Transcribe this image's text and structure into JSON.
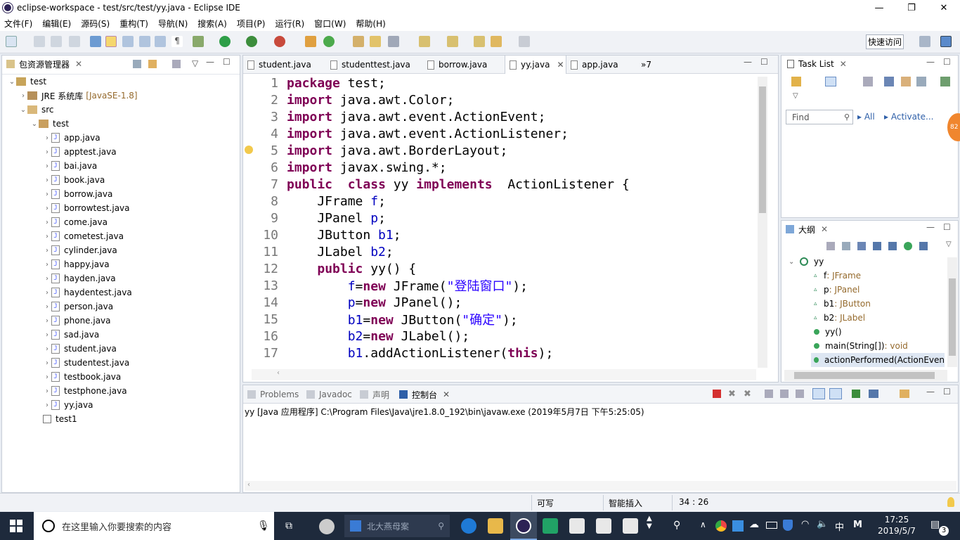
{
  "window": {
    "title": "eclipse-workspace - test/src/test/yy.java - Eclipse IDE"
  },
  "menu": [
    "文件(F)",
    "编辑(E)",
    "源码(S)",
    "重构(T)",
    "导航(N)",
    "搜索(A)",
    "项目(P)",
    "运行(R)",
    "窗口(W)",
    "帮助(H)"
  ],
  "toolbar": {
    "quick_access": "快速访问"
  },
  "package_explorer": {
    "tab": "包资源管理器",
    "project": "test",
    "jre": "JRE 系统库",
    "jre_version": "[JavaSE-1.8]",
    "src": "src",
    "package": "test",
    "files": [
      "app.java",
      "apptest.java",
      "bai.java",
      "book.java",
      "borrow.java",
      "borrowtest.java",
      "come.java",
      "cometest.java",
      "cylinder.java",
      "happy.java",
      "hayden.java",
      "haydentest.java",
      "person.java",
      "phone.java",
      "sad.java",
      "student.java",
      "studentest.java",
      "testbook.java",
      "testphone.java",
      "yy.java"
    ],
    "project2": "test1"
  },
  "editor": {
    "tabs": [
      "student.java",
      "studenttest.java",
      "borrow.java",
      "yy.java",
      "app.java"
    ],
    "overflow": "»7",
    "lines": [
      {
        "n": "1",
        "parts": [
          {
            "t": "package",
            "c": "kw"
          },
          {
            "t": " test;",
            "c": ""
          }
        ]
      },
      {
        "n": "2",
        "parts": [
          {
            "t": "import",
            "c": "kw"
          },
          {
            "t": " java.awt.Color;",
            "c": ""
          }
        ]
      },
      {
        "n": "3",
        "parts": [
          {
            "t": "import",
            "c": "kw"
          },
          {
            "t": " java.awt.event.ActionEvent;",
            "c": ""
          }
        ]
      },
      {
        "n": "4",
        "parts": [
          {
            "t": "import",
            "c": "kw"
          },
          {
            "t": " java.awt.event.ActionListener;",
            "c": ""
          }
        ]
      },
      {
        "n": "5",
        "parts": [
          {
            "t": "import",
            "c": "kw"
          },
          {
            "t": " java.awt.BorderLayout;",
            "c": ""
          }
        ]
      },
      {
        "n": "6",
        "parts": [
          {
            "t": "import",
            "c": "kw"
          },
          {
            "t": " javax.swing.*;",
            "c": ""
          }
        ]
      },
      {
        "n": "7",
        "parts": [
          {
            "t": "public",
            "c": "kw"
          },
          {
            "t": "  ",
            "c": ""
          },
          {
            "t": "class",
            "c": "kw"
          },
          {
            "t": " yy ",
            "c": ""
          },
          {
            "t": "implements",
            "c": "kw"
          },
          {
            "t": "  ActionListener {",
            "c": ""
          }
        ]
      },
      {
        "n": "8",
        "parts": [
          {
            "t": "    JFrame ",
            "c": ""
          },
          {
            "t": "f",
            "c": "fld"
          },
          {
            "t": ";",
            "c": ""
          }
        ]
      },
      {
        "n": "9",
        "parts": [
          {
            "t": "    JPanel ",
            "c": ""
          },
          {
            "t": "p",
            "c": "fld"
          },
          {
            "t": ";",
            "c": ""
          }
        ]
      },
      {
        "n": "10",
        "parts": [
          {
            "t": "    JButton ",
            "c": ""
          },
          {
            "t": "b1",
            "c": "fld"
          },
          {
            "t": ";",
            "c": ""
          }
        ]
      },
      {
        "n": "11",
        "parts": [
          {
            "t": "    JLabel ",
            "c": ""
          },
          {
            "t": "b2",
            "c": "fld"
          },
          {
            "t": ";",
            "c": ""
          }
        ]
      },
      {
        "n": "12",
        "parts": [
          {
            "t": "    ",
            "c": ""
          },
          {
            "t": "public",
            "c": "kw"
          },
          {
            "t": " yy() {",
            "c": ""
          }
        ]
      },
      {
        "n": "13",
        "parts": [
          {
            "t": "        ",
            "c": ""
          },
          {
            "t": "f",
            "c": "fld"
          },
          {
            "t": "=",
            "c": ""
          },
          {
            "t": "new",
            "c": "kw"
          },
          {
            "t": " JFrame(",
            "c": ""
          },
          {
            "t": "\"登陆窗口\"",
            "c": "str"
          },
          {
            "t": ");",
            "c": ""
          }
        ]
      },
      {
        "n": "14",
        "parts": [
          {
            "t": "        ",
            "c": ""
          },
          {
            "t": "p",
            "c": "fld"
          },
          {
            "t": "=",
            "c": ""
          },
          {
            "t": "new",
            "c": "kw"
          },
          {
            "t": " JPanel();",
            "c": ""
          }
        ]
      },
      {
        "n": "15",
        "parts": [
          {
            "t": "        ",
            "c": ""
          },
          {
            "t": "b1",
            "c": "fld"
          },
          {
            "t": "=",
            "c": ""
          },
          {
            "t": "new",
            "c": "kw"
          },
          {
            "t": " JButton(",
            "c": ""
          },
          {
            "t": "\"确定\"",
            "c": "str"
          },
          {
            "t": ");",
            "c": ""
          }
        ]
      },
      {
        "n": "16",
        "parts": [
          {
            "t": "        ",
            "c": ""
          },
          {
            "t": "b2",
            "c": "fld"
          },
          {
            "t": "=",
            "c": ""
          },
          {
            "t": "new",
            "c": "kw"
          },
          {
            "t": " JLabel();",
            "c": ""
          }
        ]
      },
      {
        "n": "17",
        "parts": [
          {
            "t": "        ",
            "c": ""
          },
          {
            "t": "b1",
            "c": "fld"
          },
          {
            "t": ".addActionListener(",
            "c": ""
          },
          {
            "t": "this",
            "c": "kw"
          },
          {
            "t": ");",
            "c": ""
          }
        ]
      }
    ]
  },
  "task_list": {
    "tab": "Task List",
    "find_placeholder": "Find",
    "all": "All",
    "activate": "Activate...",
    "badge": "82"
  },
  "outline": {
    "tab": "大纲",
    "root": "yy",
    "items": [
      {
        "name": "f",
        "type": " : JFrame",
        "kind": "field"
      },
      {
        "name": "p",
        "type": " : JPanel",
        "kind": "field"
      },
      {
        "name": "b1",
        "type": " : JButton",
        "kind": "field"
      },
      {
        "name": "b2",
        "type": " : JLabel",
        "kind": "field"
      },
      {
        "name": "yy()",
        "type": "",
        "kind": "ctor"
      },
      {
        "name": "main(String[])",
        "type": " : void",
        "kind": "static"
      },
      {
        "name": "actionPerformed(ActionEven",
        "type": "",
        "kind": "method"
      }
    ]
  },
  "console": {
    "tabs": [
      "Problems",
      "Javadoc",
      "声明",
      "控制台"
    ],
    "line": "yy [Java 应用程序] C:\\Program Files\\Java\\jre1.8.0_192\\bin\\javaw.exe  (2019年5月7日 下午5:25:05)"
  },
  "status": {
    "writable": "可写",
    "insert": "智能插入",
    "position": "34 : 26"
  },
  "taskbar": {
    "search_placeholder": "在这里输入你要搜索的内容",
    "search2": "北大燕母案",
    "ime": "中",
    "ime2": "M",
    "time": "17:25",
    "date": "2019/5/7",
    "notifications": "3"
  }
}
